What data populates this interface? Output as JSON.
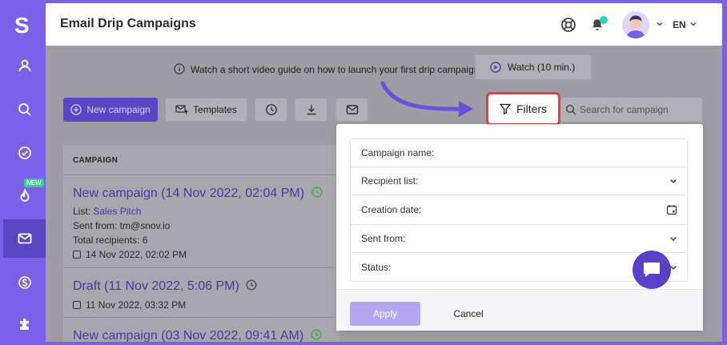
{
  "app": {
    "logo_letter": "S"
  },
  "sidebar": {
    "items": [
      {
        "name": "contacts",
        "icon": "user-icon"
      },
      {
        "name": "search",
        "icon": "search-icon"
      },
      {
        "name": "tasks",
        "icon": "check-circle-icon"
      },
      {
        "name": "warmup",
        "icon": "flame-icon",
        "badge": "NEW"
      },
      {
        "name": "campaigns",
        "icon": "mail-icon",
        "active": true
      },
      {
        "name": "billing",
        "icon": "dollar-icon"
      },
      {
        "name": "integrations",
        "icon": "puzzle-icon"
      }
    ],
    "new_badge": "NEW"
  },
  "header": {
    "title": "Email Drip Campaigns",
    "language": "EN",
    "icons": [
      "lifebuoy-icon",
      "bell-icon",
      "avatar",
      "chevron-down-icon"
    ]
  },
  "guide": {
    "text": "Watch a short video guide on how to launch your first drip campaign",
    "watch_label": "Watch (10 min.)"
  },
  "toolbar": {
    "new_campaign_label": "New campaign",
    "templates_label": "Templates",
    "filters_label": "Filters",
    "search_placeholder": "Search for campaign"
  },
  "table": {
    "header": "CAMPAIGN",
    "rows": [
      {
        "title": "New campaign (14 Nov 2022, 02:04 PM)",
        "status_color": "#3fae3f",
        "list_label": "List:",
        "list_value": "Sales Pitch",
        "sent_from_label": "Sent from:",
        "sent_from_value": "tm@snov.io",
        "recipients_label": "Total recipients:",
        "recipients_value": "6",
        "date": "14 Nov 2022, 02:02 PM"
      },
      {
        "title": "Draft (11 Nov 2022, 5:06 PM)",
        "status_color": "#555555",
        "date": "11 Nov 2022, 03:32 PM"
      },
      {
        "title": "New campaign (03 Nov 2022, 09:41 AM)",
        "status_color": "#3fae3f"
      }
    ]
  },
  "filters_panel": {
    "fields": [
      {
        "label": "Campaign name:",
        "icon": ""
      },
      {
        "label": "Recipient list:",
        "icon": "chevron-down-icon"
      },
      {
        "label": "Creation date:",
        "icon": "calendar-icon"
      },
      {
        "label": "Sent from:",
        "icon": "chevron-down-icon"
      },
      {
        "label": "Status:",
        "icon": "chevron-down-icon"
      }
    ],
    "apply_label": "Apply",
    "cancel_label": "Cancel"
  },
  "colors": {
    "brand": "#7b61e9",
    "highlight_border": "#f03b3b",
    "arrow": "#6a4fe0"
  }
}
